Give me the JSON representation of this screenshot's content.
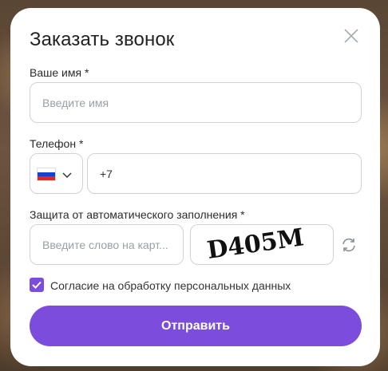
{
  "modal": {
    "title": "Заказать звонок",
    "close_icon": "close-icon"
  },
  "name_field": {
    "label": "Ваше имя *",
    "placeholder": "Введите имя",
    "value": ""
  },
  "phone_field": {
    "label": "Телефон *",
    "country_flag": "russia-flag-icon",
    "value": "+7"
  },
  "captcha": {
    "label": "Защита от автоматического заполнения *",
    "placeholder": "Введите слово на карт...",
    "image_text": "D405M",
    "refresh_icon": "refresh-icon"
  },
  "consent": {
    "checked": true,
    "label": "Согласие на обработку персональных данных"
  },
  "submit": {
    "label": "Отправить"
  },
  "colors": {
    "accent": "#7c4ddc",
    "border": "#cfd3d8",
    "text": "#222222"
  }
}
